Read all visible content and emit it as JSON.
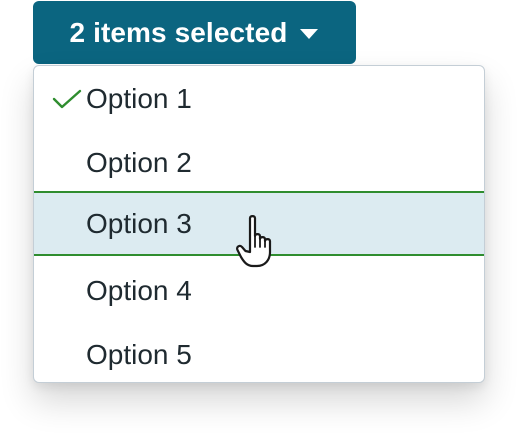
{
  "dropdown": {
    "button_label": "2 items selected",
    "button_icon": "caret-down-icon",
    "options": [
      {
        "label": "Option 1",
        "selected": true
      },
      {
        "label": "Option 2",
        "selected": false
      },
      {
        "label": "Option 3",
        "selected": false,
        "hovered": true
      },
      {
        "label": "Option 4",
        "selected": false
      },
      {
        "label": "Option 5",
        "selected": false
      }
    ]
  },
  "colors": {
    "button_bg": "#0b6580",
    "button_text": "#ffffff",
    "highlight_bg": "#dcebf1",
    "highlight_border": "#2f8d2f",
    "check": "#2f8d2f",
    "text": "#1f2a30",
    "menu_border": "#c4ced6"
  },
  "cursor": {
    "icon": "hand-pointer-icon"
  }
}
